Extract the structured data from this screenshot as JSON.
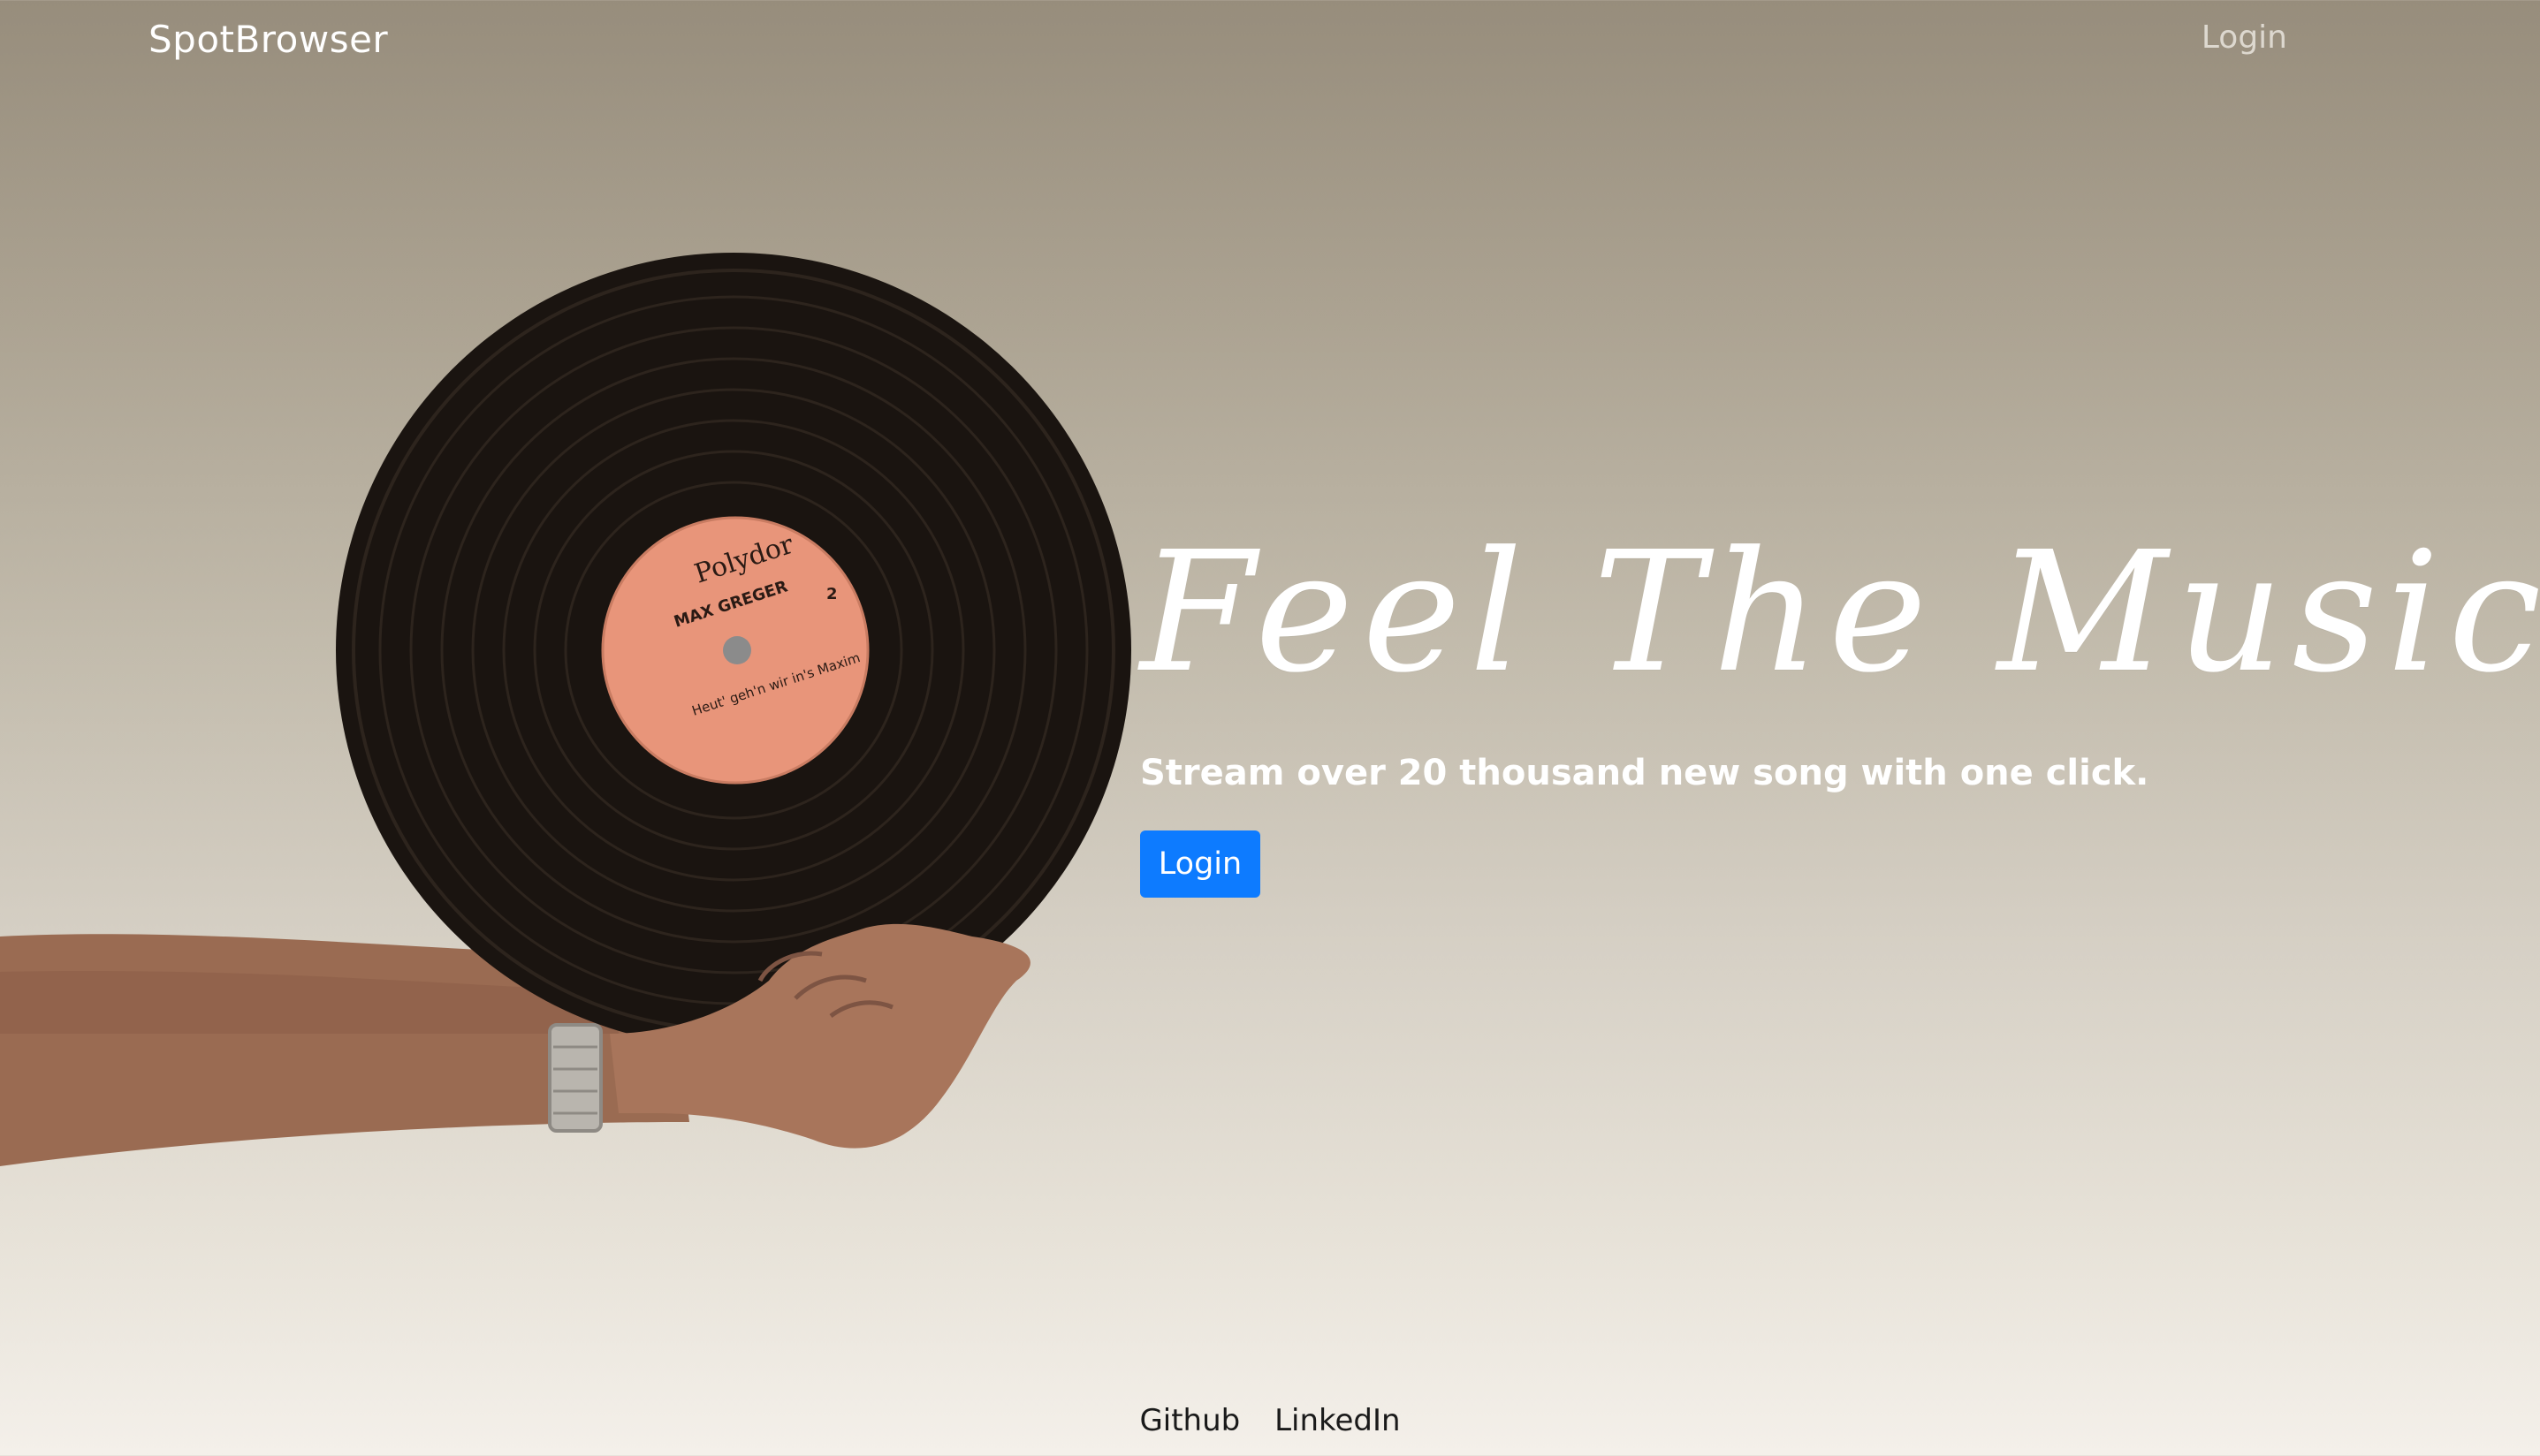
{
  "navbar": {
    "brand": "SpotBrowser",
    "login_label": "Login"
  },
  "hero": {
    "title": "Feel The Music",
    "subtitle": "Stream over 20 thousand new song with one click.",
    "login_button": "Login",
    "record_label": {
      "brand": "Polydor",
      "artist": "MAX GREGER",
      "side": "2",
      "track": "Heut' geh'n wir in's Maxim"
    }
  },
  "footer": {
    "links": [
      "Github",
      "LinkedIn"
    ]
  },
  "colors": {
    "accent": "#0d7bff",
    "record": "#1a1410",
    "label": "#e8957a"
  }
}
